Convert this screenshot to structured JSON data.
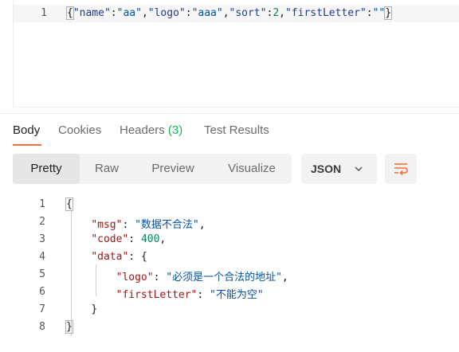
{
  "request": {
    "line_number": "1",
    "parts": {
      "open": "{",
      "k1": "\"name\"",
      "c1": ":",
      "v1": "\"aa\"",
      "s1": ",",
      "k2": "\"logo\"",
      "c2": ":",
      "v2": "\"aaa\"",
      "s2": ",",
      "k3": "\"sort\"",
      "c3": ":",
      "v3": "2",
      "s3": ",",
      "k4": "\"firstLetter\"",
      "c4": ":",
      "v4": "\"\"",
      "close": "}"
    }
  },
  "tabs": {
    "body": "Body",
    "cookies": "Cookies",
    "headers": "Headers",
    "headers_count": "(3)",
    "test_results": "Test Results"
  },
  "toolbar": {
    "pretty": "Pretty",
    "raw": "Raw",
    "preview": "Preview",
    "visualize": "Visualize",
    "format": "JSON",
    "format_icon": "chevron-down-icon",
    "wrap_icon": "wrap-lines-icon"
  },
  "response": {
    "lines": [
      "1",
      "2",
      "3",
      "4",
      "5",
      "6",
      "7",
      "8"
    ],
    "l1": "{",
    "l2_key": "\"msg\"",
    "l2_sep": ": ",
    "l2_val": "\"数据不合法\"",
    "l2_end": ",",
    "l3_key": "\"code\"",
    "l3_sep": ": ",
    "l3_val": "400",
    "l3_end": ",",
    "l4_key": "\"data\"",
    "l4_sep": ": ",
    "l4_open": "{",
    "l5_key": "\"logo\"",
    "l5_sep": ": ",
    "l5_val": "\"必须是一个合法的地址\"",
    "l5_end": ",",
    "l6_key": "\"firstLetter\"",
    "l6_sep": ": ",
    "l6_val": "\"不能为空\"",
    "l7": "}",
    "l8": "}"
  },
  "colors": {
    "accent": "#ff6c37",
    "count_green": "#0cbb52"
  }
}
